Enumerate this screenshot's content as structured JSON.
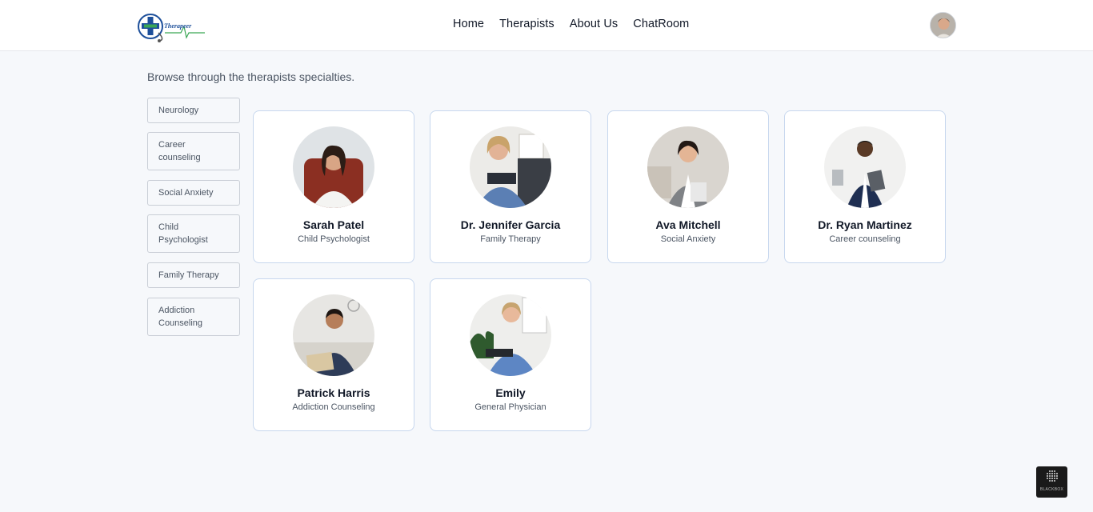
{
  "brand": {
    "logo_text": "Therapeer",
    "logo_icon": "medical-cross-stethoscope-logo"
  },
  "nav": {
    "links": [
      {
        "label": "Home"
      },
      {
        "label": "Therapists"
      },
      {
        "label": "About Us"
      },
      {
        "label": "ChatRoom"
      }
    ],
    "avatar_icon": "user-avatar"
  },
  "intro": "Browse through the therapists specialties.",
  "specialties": [
    {
      "label": "Neurology"
    },
    {
      "label": "Career counseling"
    },
    {
      "label": "Social Anxiety"
    },
    {
      "label": "Child Psychologist"
    },
    {
      "label": "Family Therapy"
    },
    {
      "label": "Addiction Counseling"
    }
  ],
  "therapists": [
    {
      "name": "Sarah Patel",
      "specialty": "Child Psychologist"
    },
    {
      "name": "Dr. Jennifer Garcia",
      "specialty": "Family Therapy"
    },
    {
      "name": "Ava Mitchell",
      "specialty": "Social Anxiety"
    },
    {
      "name": "Dr. Ryan Martinez",
      "specialty": "Career counseling"
    },
    {
      "name": "Patrick Harris",
      "specialty": "Addiction Counseling"
    },
    {
      "name": "Emily",
      "specialty": "General Physician"
    }
  ],
  "widget": {
    "label": "BLACKBOX",
    "icon": "blackbox-grid-icon"
  },
  "colors": {
    "card_border": "#c7d7ee",
    "page_bg": "#f6f8fb",
    "brand_blue": "#1d4f9a",
    "brand_green": "#3aa655"
  }
}
